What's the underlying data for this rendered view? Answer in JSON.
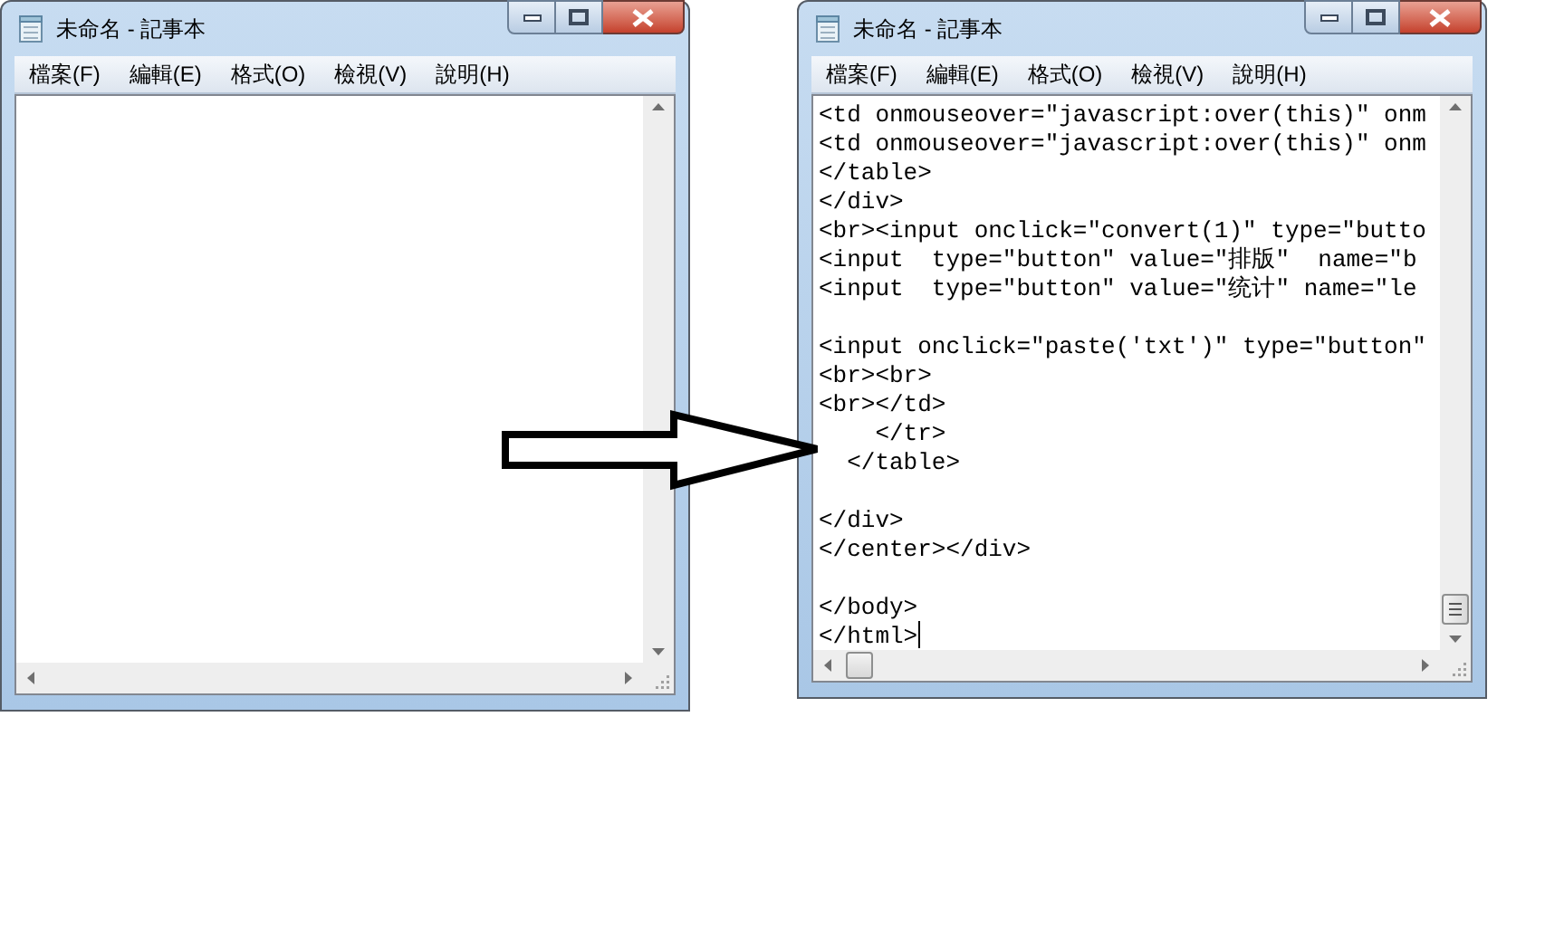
{
  "windows": [
    {
      "title": "未命名 - 記事本",
      "menu": [
        "檔案(F)",
        "編輯(E)",
        "格式(O)",
        "檢視(V)",
        "說明(H)"
      ]
    },
    {
      "title": "未命名 - 記事本",
      "menu": [
        "檔案(F)",
        "編輯(E)",
        "格式(O)",
        "檢視(V)",
        "說明(H)"
      ],
      "content": "<td onmouseover=\"javascript:over(this)\" onm\n<td onmouseover=\"javascript:over(this)\" onm\n</table>\n</div>\n<br><input onclick=\"convert(1)\" type=\"butto\n<input  type=\"button\" value=\"排版\"  name=\"b\n<input  type=\"button\" value=\"统计\" name=\"le\n\n<input onclick=\"paste('txt')\" type=\"button\"\n<br><br>\n<br></td>\n    </tr>\n  </table>\n\n</div>\n</center></div>\n\n</body>\n</html>"
    }
  ]
}
